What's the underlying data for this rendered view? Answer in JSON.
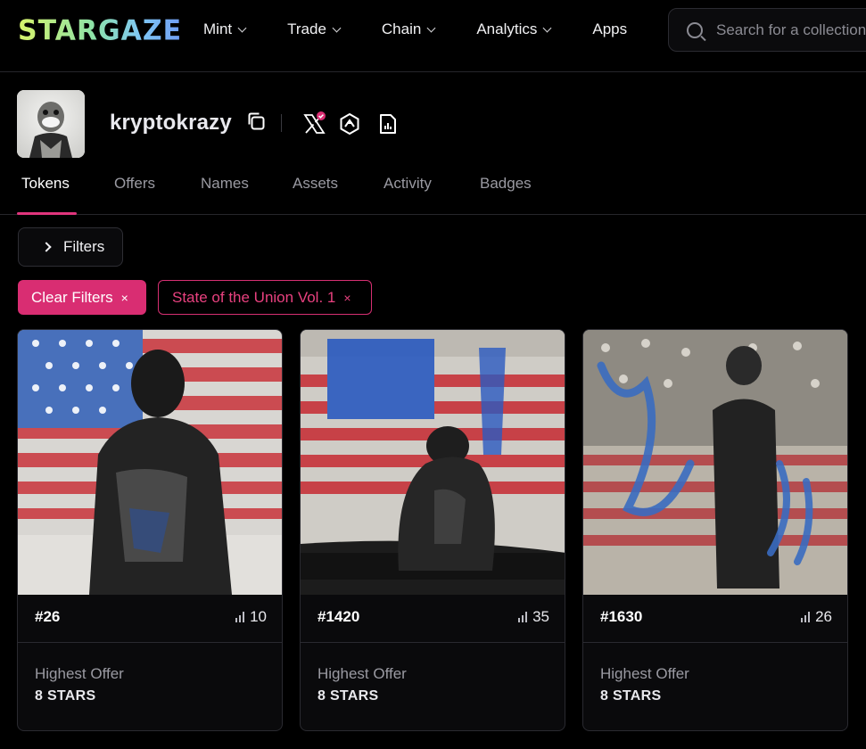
{
  "app": {
    "logo": "STARGAZE"
  },
  "nav": [
    {
      "label": "Mint",
      "has_dropdown": true
    },
    {
      "label": "Trade",
      "has_dropdown": true
    },
    {
      "label": "Chain",
      "has_dropdown": true
    },
    {
      "label": "Analytics",
      "has_dropdown": true
    },
    {
      "label": "Apps",
      "has_dropdown": false
    }
  ],
  "search": {
    "placeholder": "Search for a collection"
  },
  "profile": {
    "username": "kryptokrazy",
    "icons": [
      "copy-icon",
      "x-verified-icon",
      "stargaze-icon",
      "report-icon"
    ]
  },
  "tabs": [
    {
      "label": "Tokens",
      "active": true
    },
    {
      "label": "Offers",
      "active": false
    },
    {
      "label": "Names",
      "active": false
    },
    {
      "label": "Assets",
      "active": false
    },
    {
      "label": "Activity",
      "active": false
    },
    {
      "label": "Badges",
      "active": false
    }
  ],
  "filters": {
    "button_label": "Filters",
    "clear_label": "Clear Filters",
    "active_filter": "State of the Union Vol. 1",
    "remove_glyph": "×"
  },
  "colors": {
    "accent": "#d92d72",
    "background": "#000000",
    "border": "#2a2a30",
    "muted_text": "#9a9aa2"
  },
  "cards": [
    {
      "token": "#26",
      "rank": "10",
      "offer_label": "Highest Offer",
      "offer_value": "8 STARS"
    },
    {
      "token": "#1420",
      "rank": "35",
      "offer_label": "Highest Offer",
      "offer_value": "8 STARS"
    },
    {
      "token": "#1630",
      "rank": "26",
      "offer_label": "Highest Offer",
      "offer_value": "8 STARS"
    }
  ]
}
